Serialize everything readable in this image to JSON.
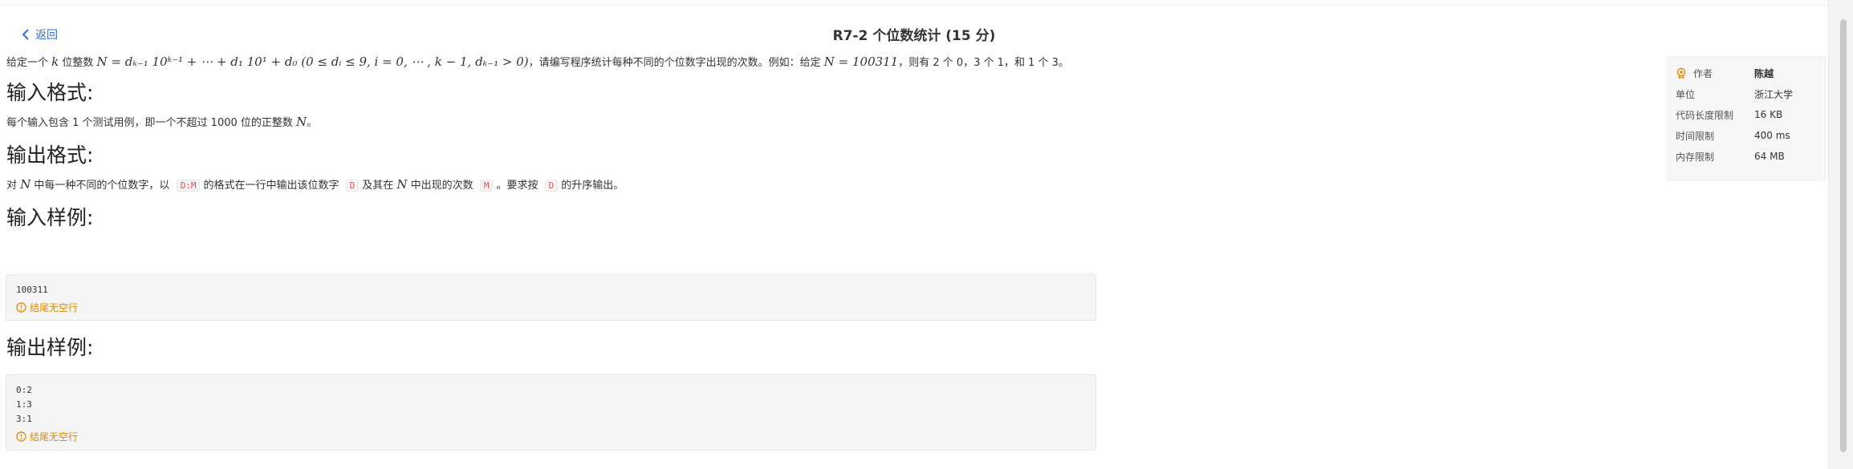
{
  "header": {
    "back_label": "返回",
    "title": "R7-2 个位数统计 (15 分)"
  },
  "problem": {
    "intro": {
      "t1": "给定一个",
      "m1": "k",
      "t2": "位整数",
      "m2": "N = dₖ₋₁ 10ᵏ⁻¹ + ⋯ + d₁ 10¹ + d₀ (0 ≤ dᵢ ≤ 9, i = 0, ⋯ , k − 1, dₖ₋₁ > 0)",
      "t3": "，请编写程序统计每种不同的个位数字出现的次数。例如：给定",
      "m3": "N = 100311",
      "t4": "，则有 2 个 0，3 个 1，和 1 个 3。"
    },
    "input_format": {
      "heading": "输入格式:",
      "t1": "每个输入包含 1 个测试用例，即一个不超过 1000 位的正整数",
      "m1": "N",
      "t2": "。"
    },
    "output_format": {
      "heading": "输出格式:",
      "t1": "对",
      "m1": "N",
      "t2": "中每一种不同的个位数字，以",
      "c1": "D:M",
      "t3": "的格式在一行中输出该位数字",
      "c2": "D",
      "t4": "及其在",
      "m2": "N",
      "t5": "中出现的次数",
      "c3": "M",
      "t6": "。要求按",
      "c4": "D",
      "t7": "的升序输出。"
    },
    "sample_input": {
      "heading": "输入样例:",
      "code": "100311",
      "note": "结尾无空行"
    },
    "sample_output": {
      "heading": "输出样例:",
      "code": "0:2\n1:3\n3:1",
      "note": "结尾无空行"
    }
  },
  "info": {
    "author_label": "作者",
    "author": "陈越",
    "org_label": "单位",
    "org": "浙江大学",
    "code_limit_label": "代码长度限制",
    "code_limit": "16 KB",
    "time_limit_label": "时间限制",
    "time_limit": "400 ms",
    "mem_limit_label": "内存限制",
    "mem_limit": "64 MB"
  },
  "colors": {
    "link": "#2f6fd1",
    "warning": "#e08a00",
    "inline_code": "#d9534f"
  },
  "icons": {
    "back": "chevron-left-icon",
    "warning": "alert-circle-icon",
    "author": "medal-icon"
  }
}
